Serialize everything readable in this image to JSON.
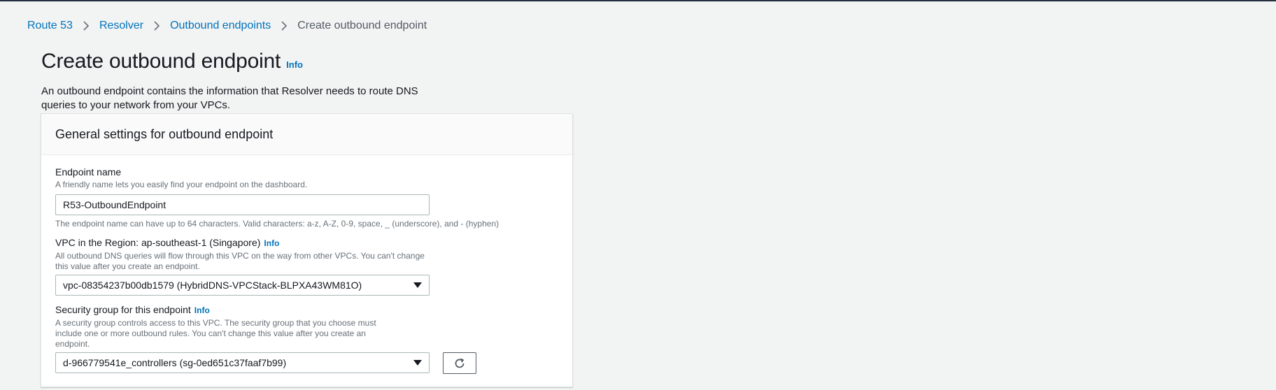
{
  "breadcrumb": {
    "items": [
      "Route 53",
      "Resolver",
      "Outbound endpoints"
    ],
    "current": "Create outbound endpoint"
  },
  "page": {
    "title": "Create outbound endpoint",
    "info": "Info",
    "description": "An outbound endpoint contains the information that Resolver needs to route DNS queries to your network from your VPCs."
  },
  "panel": {
    "title": "General settings for outbound endpoint",
    "endpoint_name": {
      "label": "Endpoint name",
      "description": "A friendly name lets you easily find your endpoint on the dashboard.",
      "value": "R53-OutboundEndpoint",
      "constraint": "The endpoint name can have up to 64 characters. Valid characters: a-z, A-Z, 0-9, space, _ (underscore), and - (hyphen)"
    },
    "vpc": {
      "label": "VPC in the Region: ap-southeast-1 (Singapore)",
      "info": "Info",
      "description": "All outbound DNS queries will flow through this VPC on the way from other VPCs. You can't change this value after you create an endpoint.",
      "selected": "vpc-08354237b00db1579 (HybridDNS-VPCStack-BLPXA43WM81O)"
    },
    "security_group": {
      "label": "Security group for this endpoint",
      "info": "Info",
      "description": "A security group controls access to this VPC. The security group that you choose must include one or more outbound rules. You can't change this value after you create an endpoint.",
      "selected": "d-966779541e_controllers (sg-0ed651c37faaf7b99)"
    }
  },
  "colors": {
    "link": "#0073bb",
    "text": "#16191f",
    "background": "#f2f3f3"
  }
}
